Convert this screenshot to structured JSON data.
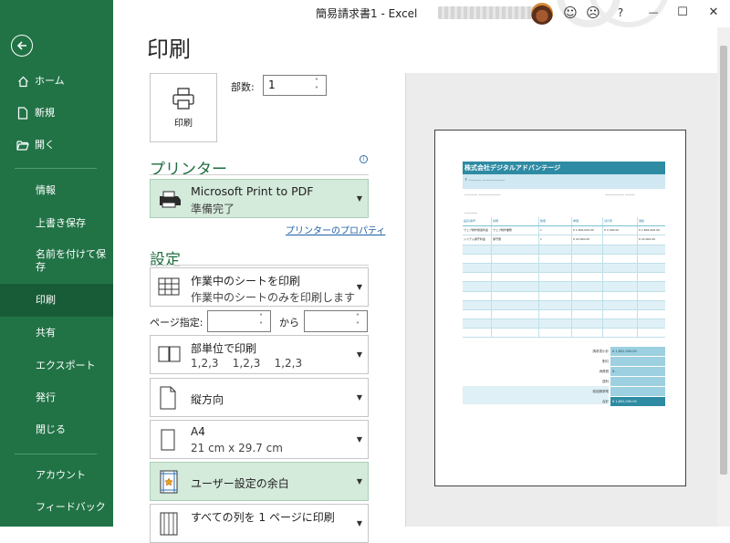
{
  "app": {
    "title": "簡易請求書1  -  Excel"
  },
  "sidebar": {
    "items": [
      {
        "label": "ホーム",
        "icon": "home-icon"
      },
      {
        "label": "新規",
        "icon": "new-file-icon"
      },
      {
        "label": "開く",
        "icon": "folder-open-icon"
      },
      {
        "label": "情報"
      },
      {
        "label": "上書き保存"
      },
      {
        "label": "名前を付けて保\n存"
      },
      {
        "label": "印刷",
        "selected": true
      },
      {
        "label": "共有"
      },
      {
        "label": "エクスポート"
      },
      {
        "label": "発行"
      },
      {
        "label": "閉じる"
      },
      {
        "label": "アカウント"
      },
      {
        "label": "フィードバック"
      }
    ]
  },
  "titlebar": {
    "smile": "☺",
    "frown": "☹",
    "help": "?",
    "minimize": "—",
    "restore": "☐",
    "close": "✕"
  },
  "print": {
    "page_title": "印刷",
    "print_button": "印刷",
    "copies_label": "部数:",
    "copies_value": "1"
  },
  "printer": {
    "header": "プリンター",
    "name": "Microsoft Print to PDF",
    "status": "準備完了",
    "properties_link": "プリンターのプロパティ"
  },
  "settings": {
    "header": "設定",
    "what": {
      "main": "作業中のシートを印刷",
      "sub": "作業中のシートのみを印刷します"
    },
    "pages_label": "ページ指定:",
    "to_label": "から",
    "collate": {
      "main": "部単位で印刷",
      "sub": "1,2,3    1,2,3    1,2,3"
    },
    "orientation": {
      "main": "縦方向"
    },
    "paper": {
      "main": "A4",
      "sub": "21 cm x 29.7 cm"
    },
    "margins": {
      "main": "ユーザー設定の余白"
    },
    "scaling": {
      "main": "すべての列を 1 ページに印刷"
    }
  },
  "preview": {
    "company": "株式会社デジタルアドバンテージ",
    "header_cols": [
      "品目/番号",
      "説明",
      "数量",
      "単価",
      "割引率",
      "価格"
    ],
    "rows": [
      [
        "ウェブ制作関連料金",
        "ウェブ制作業務",
        "1",
        "¥ 1,802,000.00",
        "¥ 2,300.00",
        "¥ 1,802,000.00"
      ],
      [
        "システム保守料金",
        "保守費",
        "1",
        "¥ 22,000.00",
        "",
        "¥ 22,000.00"
      ]
    ],
    "summary": [
      {
        "label": "請求書小計",
        "value": "¥ 1,802,000.00"
      },
      {
        "label": "割引",
        "value": ""
      },
      {
        "label": "消費税",
        "value": "¥ -"
      },
      {
        "label": "送料",
        "value": ""
      },
      {
        "label": "前回請求残",
        "value": ""
      },
      {
        "label": "合計",
        "value": "¥ 1,802,000.00"
      }
    ]
  },
  "colors": {
    "sidebar": "#217346",
    "sidebar_selected": "#185c37",
    "accent": "#1e6e3f",
    "selected_dropdown": "#d4eadb",
    "invoice_header": "#2e8ba3"
  }
}
